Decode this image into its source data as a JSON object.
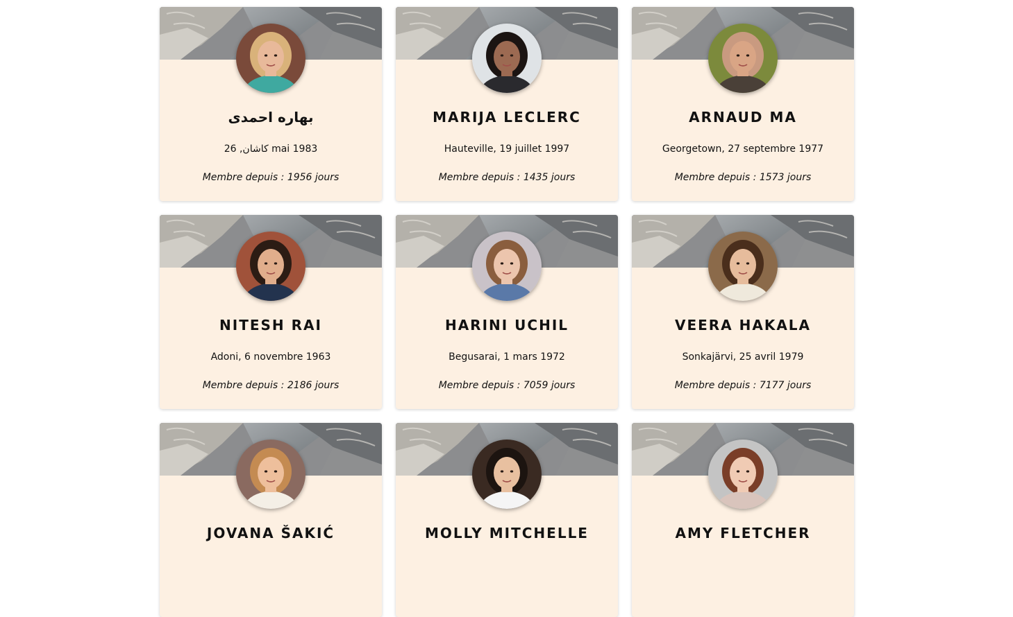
{
  "cards": [
    {
      "name": "بهاره احمدی",
      "birth": "کاشان, 26 mai 1983",
      "member": "Membre depuis : 1956 jours",
      "avatar": {
        "skin": "#e8b99a",
        "hair": "#d9b27a",
        "shirt": "#3fa9a0",
        "bg": "#7a4a3a"
      }
    },
    {
      "name": "MARIJA LECLERC",
      "birth": "Hauteville, 19 juillet 1997",
      "member": "Membre depuis : 1435 jours",
      "avatar": {
        "skin": "#9c6a52",
        "hair": "#1b1412",
        "shirt": "#2a2a2e",
        "bg": "#dfe3e6"
      }
    },
    {
      "name": "ARNAUD MA",
      "birth": "Georgetown, 27 septembre 1977",
      "member": "Membre depuis : 1573 jours",
      "avatar": {
        "skin": "#d9a585",
        "hair": "#c99a80",
        "shirt": "#4a4038",
        "bg": "#7c8a3c"
      }
    },
    {
      "name": "NITESH RAI",
      "birth": "Adoni, 6 novembre 1963",
      "member": "Membre depuis : 2186 jours",
      "avatar": {
        "skin": "#e1ae8c",
        "hair": "#2c1c14",
        "shirt": "#23334e",
        "bg": "#a0523a"
      }
    },
    {
      "name": "HARINI UCHIL",
      "birth": "Begusarai, 1 mars 1972",
      "member": "Membre depuis : 7059 jours",
      "avatar": {
        "skin": "#ecc5ad",
        "hair": "#8a5e3e",
        "shirt": "#5a79a8",
        "bg": "#c9c2c8"
      }
    },
    {
      "name": "VEERA HAKALA",
      "birth": "Sonkajärvi, 25 avril 1979",
      "member": "Membre depuis : 7177 jours",
      "avatar": {
        "skin": "#e6bc9c",
        "hair": "#4a2e1c",
        "shirt": "#efe9dc",
        "bg": "#8b6a4a"
      }
    },
    {
      "name": "JOVANA ŠAKIĆ",
      "birth": "",
      "member": "",
      "avatar": {
        "skin": "#eebf9c",
        "hair": "#c48b52",
        "shirt": "#f4efe6",
        "bg": "#8a6a60"
      }
    },
    {
      "name": "MOLLY MITCHELLE",
      "birth": "",
      "member": "",
      "avatar": {
        "skin": "#e8c0a0",
        "hair": "#1c1410",
        "shirt": "#f5f5f5",
        "bg": "#3a2a22"
      }
    },
    {
      "name": "AMY FLETCHER",
      "birth": "",
      "member": "",
      "avatar": {
        "skin": "#f0cbb4",
        "hair": "#7a3e28",
        "shirt": "#d9c4bc",
        "bg": "#c4c4c4"
      }
    }
  ]
}
